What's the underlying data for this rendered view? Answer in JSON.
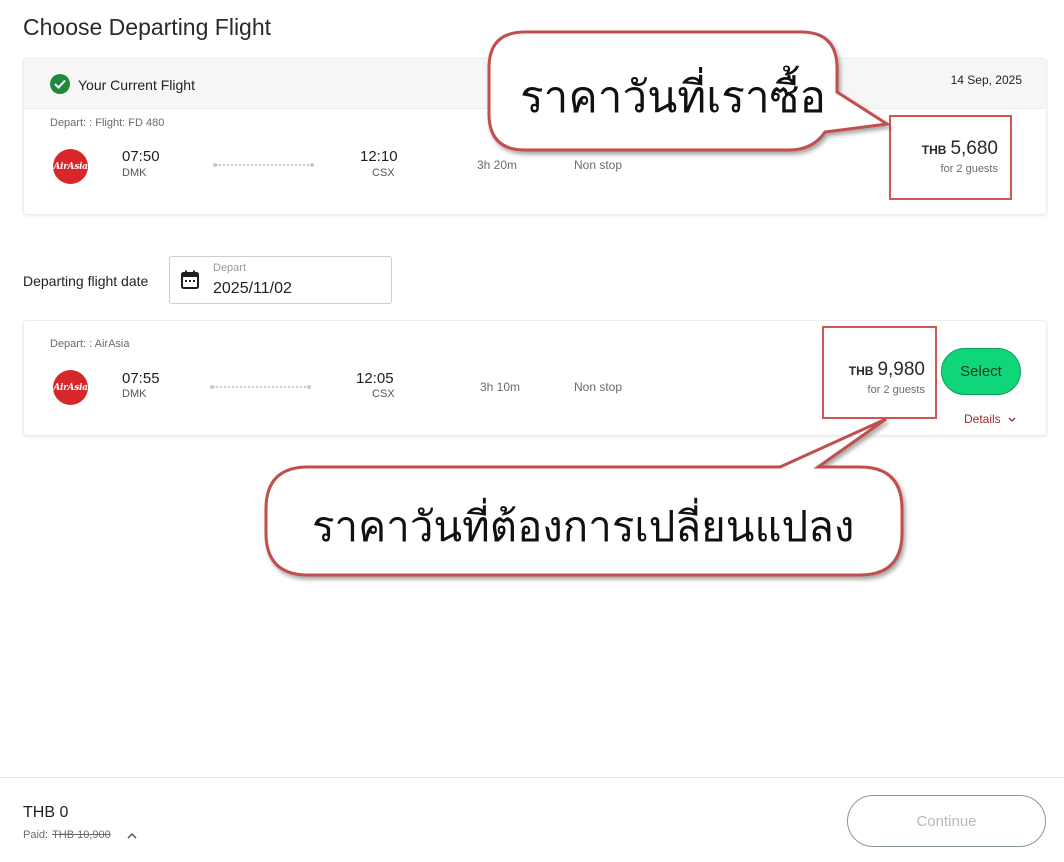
{
  "page_title": "Choose Departing Flight",
  "current_flight": {
    "label": "Your Current Flight",
    "date": "14 Sep, 2025",
    "depart_line": "Depart: : Flight: FD 480",
    "logo_text": "AirAsia",
    "depart_time": "07:50",
    "depart_code": "DMK",
    "arrive_time": "12:10",
    "arrive_code": "CSX",
    "duration": "3h 20m",
    "stops": "Non stop",
    "currency": "THB",
    "price": "5,680",
    "guests": "for 2 guests"
  },
  "date_picker": {
    "label": "Departing flight date",
    "placeholder": "Depart",
    "value": "2025/11/02"
  },
  "option_flight": {
    "depart_line": "Depart: : AirAsia",
    "logo_text": "AirAsia",
    "depart_time": "07:55",
    "depart_code": "DMK",
    "arrive_time": "12:05",
    "arrive_code": "CSX",
    "duration": "3h 10m",
    "stops": "Non stop",
    "currency": "THB",
    "price": "9,980",
    "guests": "for 2 guests",
    "select_label": "Select",
    "details_label": "Details"
  },
  "callouts": {
    "top": "ราคาวันที่เราซื้อ",
    "bottom": "ราคาวันที่ต้องการเปลี่ยนแปลง"
  },
  "footer": {
    "total": "THB 0",
    "paid_label": "Paid:",
    "paid_value": "THB 10,900",
    "continue_label": "Continue"
  },
  "colors": {
    "brand_red": "#d8272a",
    "select_green": "#10d67a",
    "highlight": "#d0574e",
    "check_green": "#1f8a3a"
  }
}
